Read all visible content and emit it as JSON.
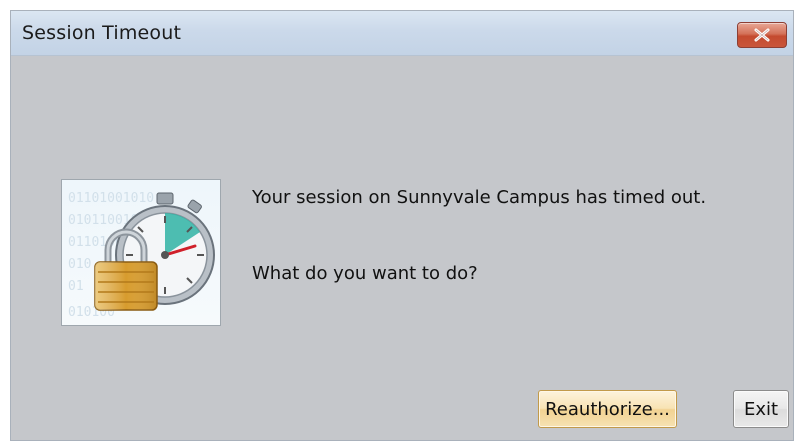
{
  "window": {
    "title": "Session Timeout",
    "close_icon": "close-icon"
  },
  "dialog": {
    "icon": "stopwatch-lock-icon",
    "binary_rows": [
      "01101001010",
      "0101100101",
      "0110100",
      "010",
      "01",
      "010100"
    ],
    "message": "Your session on Sunnyvale Campus has timed out.",
    "question": "What do you want to do?"
  },
  "buttons": {
    "reauthorize_label": "Reauthorize...",
    "exit_label": "Exit"
  },
  "colors": {
    "dialog_bg": "#c5c7cb",
    "titlebar_bg": "#cbd9ea",
    "close_red": "#c9563a",
    "default_button_bg": "#f6e2b2"
  }
}
